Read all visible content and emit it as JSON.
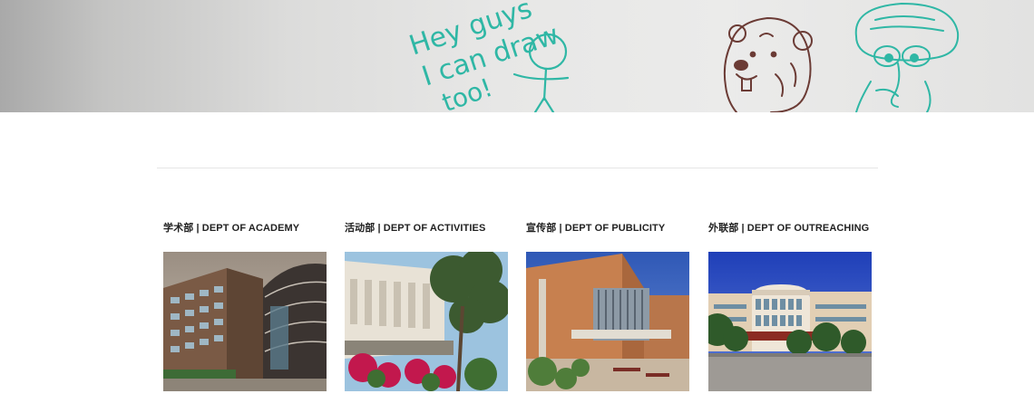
{
  "hero": {
    "doodle_lines": [
      "Hey guys",
      "I can draw",
      "too!"
    ],
    "marker_color": "#2fb7a5",
    "bear_color": "#6b3b35"
  },
  "departments": [
    {
      "title": "学术部 | DEPT OF ACADEMY",
      "photo_icon": "building-photo-academy"
    },
    {
      "title": "活动部 | DEPT OF ACTIVITIES",
      "photo_icon": "building-photo-activities"
    },
    {
      "title": "宣传部 | DEPT OF PUBLICITY",
      "photo_icon": "building-photo-publicity"
    },
    {
      "title": "外联部 | DEPT OF OUTREACHING",
      "photo_icon": "building-photo-outreaching"
    }
  ]
}
